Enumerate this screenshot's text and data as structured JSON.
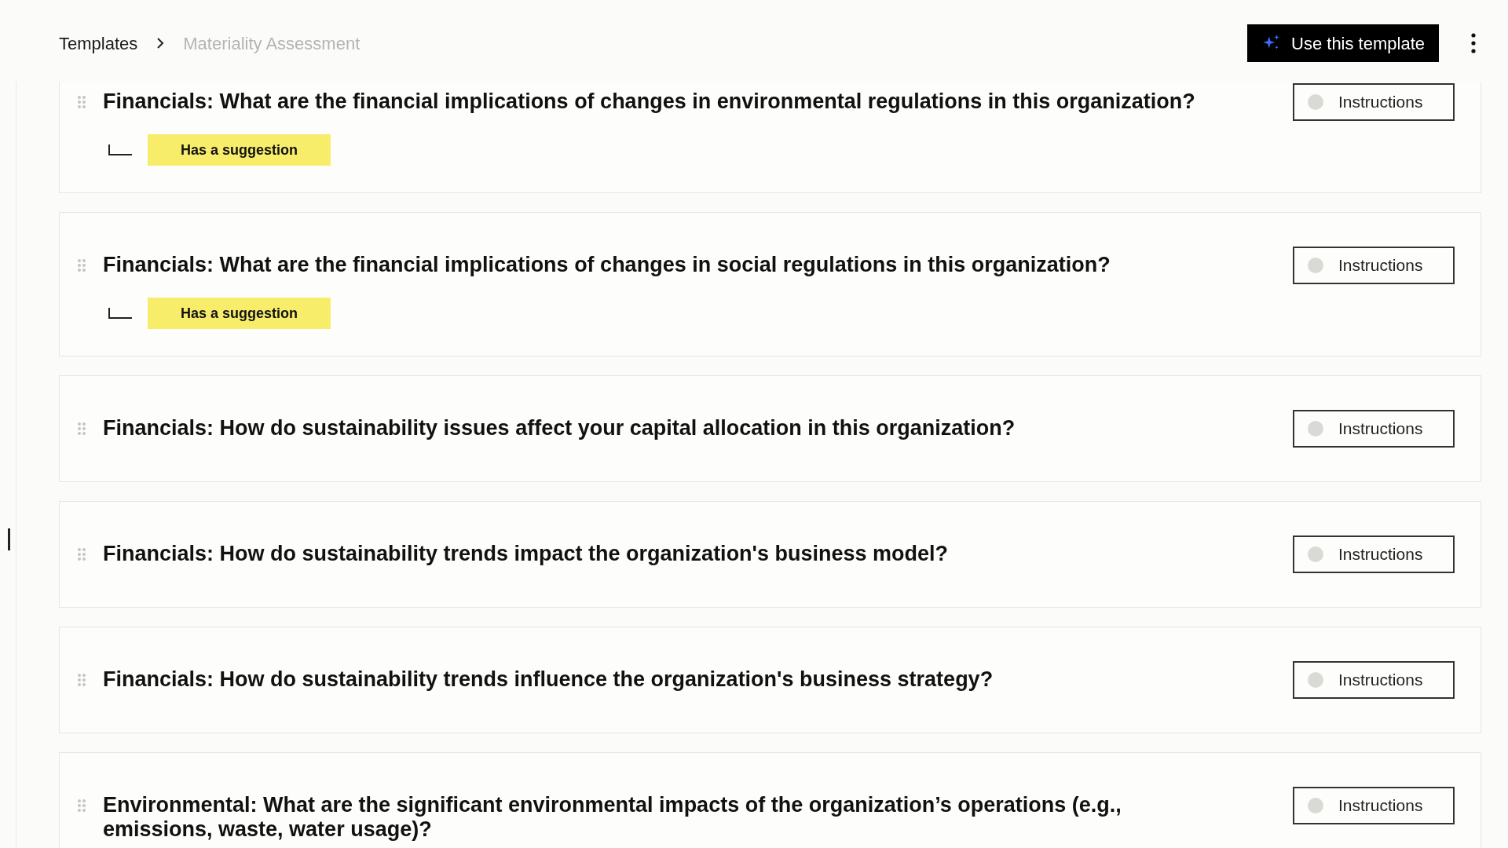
{
  "breadcrumb": [
    {
      "label": "Templates",
      "current": false
    },
    {
      "label": "Materiality Assessment",
      "current": true
    }
  ],
  "primary_button": {
    "label": "Use this template"
  },
  "questions": [
    {
      "text": "Financials: What are the financial implications of changes in environmental regulations in this organization?",
      "instructions_label": "Instructions",
      "has_suggestion": true,
      "suggestion_label": "Has a suggestion"
    },
    {
      "text": "Financials: What are the financial implications of changes in social regulations in this organization?",
      "instructions_label": "Instructions",
      "has_suggestion": true,
      "suggestion_label": "Has a suggestion"
    },
    {
      "text": "Financials: How do sustainability issues affect your capital allocation in this organization?",
      "instructions_label": "Instructions",
      "has_suggestion": false
    },
    {
      "text": "Financials: How do sustainability trends impact the organization's business model?",
      "instructions_label": "Instructions",
      "has_suggestion": false
    },
    {
      "text": "Financials: How do sustainability trends influence the organization's business strategy?",
      "instructions_label": "Instructions",
      "has_suggestion": false
    },
    {
      "text": "Environmental: What are the significant environmental impacts of the organization’s operations (e.g., emissions, waste, water usage)?",
      "instructions_label": "Instructions",
      "has_suggestion": false
    }
  ]
}
